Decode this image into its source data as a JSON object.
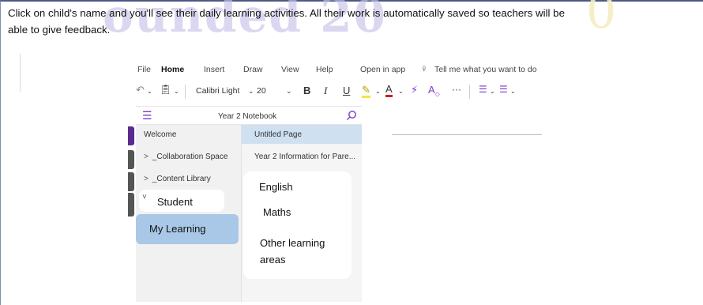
{
  "watermark": {
    "text": "ounded 20",
    "extra": "0"
  },
  "intro": {
    "part1": "Click on child's name and you'll see their daily learning activities. All their work is automatically saved so teachers will be",
    "part2": "able to give feedback."
  },
  "menu": {
    "items": [
      "File",
      "Home",
      "Insert",
      "Draw",
      "View",
      "Help",
      "Open in app",
      "Tell me what you want to do"
    ]
  },
  "toolbar": {
    "font_name": "Calibri Light",
    "font_size": "20",
    "bold": "B",
    "italic": "I",
    "underline": "U",
    "more": "···"
  },
  "notebook": {
    "title": "Year 2 Notebook"
  },
  "sections": [
    {
      "label": "Welcome",
      "chevron": ""
    },
    {
      "label": "_Collaboration Space",
      "chevron": ">"
    },
    {
      "label": "_Content Library",
      "chevron": ">"
    }
  ],
  "student": {
    "chevron": "˅",
    "label": "Student"
  },
  "my_learning": {
    "label": "My Learning"
  },
  "pages": [
    "Untitled Page",
    "Year 2 Information for Pare..."
  ],
  "subject_areas": [
    "English",
    "Maths",
    "Other learning",
    "areas"
  ],
  "colors": {
    "accent": "#7b3ac7",
    "selected_page": "#cfe0f1",
    "selected_section": "#a9c8e7",
    "highlight": "#f7e98e"
  }
}
